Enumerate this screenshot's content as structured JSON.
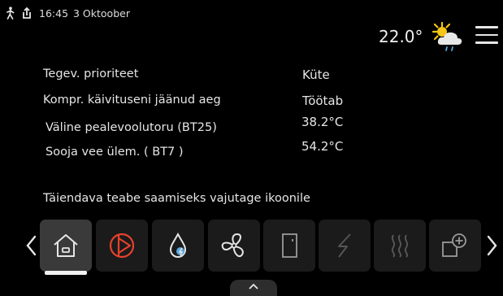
{
  "status_bar": {
    "time": "16:45",
    "date": "3 Oktoober",
    "icons": [
      "walking-person-icon",
      "share-upload-icon"
    ]
  },
  "header": {
    "outdoor_temp": "22.0°",
    "weather_icon": "sun-cloud-rain-icon",
    "menu_icon": "hamburger-menu-icon"
  },
  "info": {
    "rows": [
      {
        "label": "Tegev. prioriteet",
        "value": "Küte"
      },
      {
        "label": "Kompr. käivituseni jäänud aeg",
        "value": "Töötab"
      },
      {
        "label": "Väline pealevoolutoru   (BT25)",
        "value": "38.2°C"
      },
      {
        "label": "Sooja vee ülem. (   BT7 )",
        "value": "54.2°C"
      }
    ]
  },
  "hint": "Täiendava teabe saamiseks vajutage ikoonile",
  "icon_strip": {
    "tiles": [
      {
        "icon": "house-icon",
        "active": true
      },
      {
        "icon": "heating-play-icon",
        "active": false
      },
      {
        "icon": "hot-water-drop-icon",
        "active": false
      },
      {
        "icon": "fan-icon",
        "active": false
      },
      {
        "icon": "door-panel-icon",
        "active": false
      },
      {
        "icon": "electric-bolt-icon",
        "active": false
      },
      {
        "icon": "heat-waves-icon",
        "active": false
      },
      {
        "icon": "add-zone-icon",
        "active": false
      }
    ]
  },
  "colors": {
    "background": "#000000",
    "text": "#e6e6e6",
    "accent_red": "#e8412c",
    "water_blue": "#5aa8e0",
    "sun_yellow": "#f5c518",
    "tile_bg": "#1b1b1b",
    "tile_active_bg": "#3a3a3a"
  }
}
